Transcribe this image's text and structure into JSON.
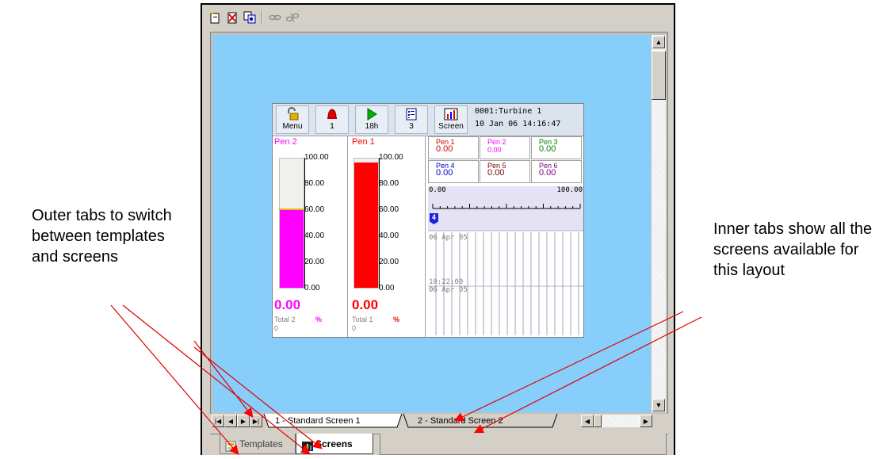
{
  "annotations": {
    "left": "Outer tabs to switch between templates and screens",
    "right": "Inner tabs show all the screens available for this layout"
  },
  "toolbar": {
    "icons": [
      "new-icon",
      "delete-icon",
      "copy-icon",
      "link-icon",
      "unlink-icon"
    ]
  },
  "device": {
    "buttons": [
      {
        "label": "Menu",
        "icon": "padlock-icon"
      },
      {
        "label": "1",
        "icon": "alarm-bell-icon"
      },
      {
        "label": "18h",
        "icon": "play-icon"
      },
      {
        "label": "3",
        "icon": "list-icon"
      },
      {
        "label": "Screen",
        "icon": "screen-icon"
      }
    ],
    "info_line1": "0001:Turbine 1",
    "info_line2": "10 Jan 06  14:16:47",
    "bar1": {
      "pen": "Pen 2",
      "color": "#ff00ff",
      "level": 0.6,
      "ticks": [
        "100.00",
        "80.00",
        "60.00",
        "40.00",
        "20.00",
        "0.00"
      ],
      "value": "0.00",
      "total_label": "Total 2",
      "unit": "%",
      "total_value": "0"
    },
    "bar2": {
      "pen": "Pen 1",
      "color": "#ff0000",
      "level": 0.97,
      "ticks": [
        "100.00",
        "80.00",
        "60.00",
        "40.00",
        "20.00",
        "0.00"
      ],
      "value": "0.00",
      "total_label": "Total 1",
      "unit": "%",
      "total_value": "0"
    },
    "digital": [
      {
        "name": "Pen 1",
        "value": "0.00",
        "color": "#cc0000"
      },
      {
        "name": "Pen 2",
        "value": "0.00",
        "color": "#ff00ff"
      },
      {
        "name": "Pen 3",
        "value": "0.00",
        "color": "#008000"
      },
      {
        "name": "Pen 4",
        "value": "0.00",
        "color": "#0000cc"
      },
      {
        "name": "Pen 5",
        "value": "0.00",
        "color": "#800000"
      },
      {
        "name": "Pen 6",
        "value": "0.00",
        "color": "#800080"
      }
    ],
    "chart": {
      "scale_min": "0.00",
      "scale_max": "100.00",
      "marker": "4",
      "date1": "06 Apr 05",
      "time2": "10:22:00",
      "date2": "06 Apr 05"
    }
  },
  "inner_tabs": [
    "1 - Standard Screen 1",
    "2 - Standard Screen 2"
  ],
  "outer_tabs": [
    "Templates",
    "Screens"
  ]
}
